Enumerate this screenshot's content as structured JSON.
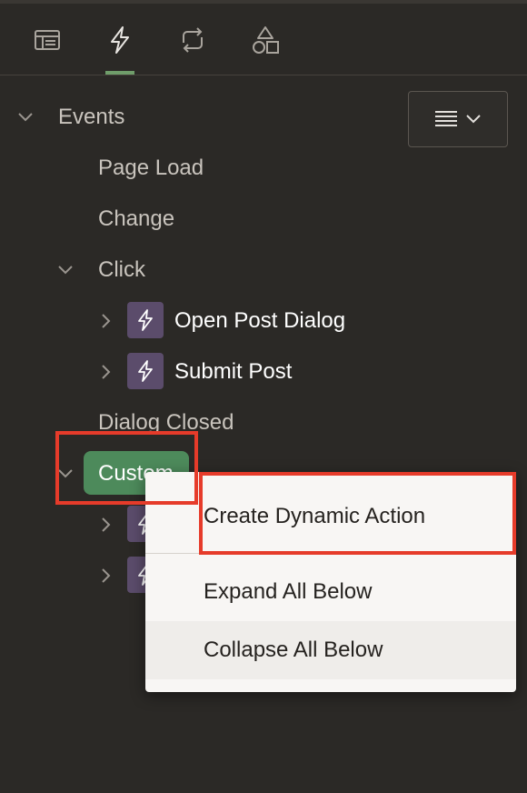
{
  "tabs": [
    {
      "icon": "rendering-icon"
    },
    {
      "icon": "dynamic-actions-icon",
      "active": true
    },
    {
      "icon": "processing-icon"
    },
    {
      "icon": "shared-components-icon"
    }
  ],
  "tree": {
    "events": {
      "label": "Events"
    },
    "page_load": {
      "label": "Page Load"
    },
    "change": {
      "label": "Change"
    },
    "click": {
      "label": "Click"
    },
    "open_post_dialog": {
      "label": "Open Post Dialog"
    },
    "submit_post": {
      "label": "Submit Post"
    },
    "dialog_closed": {
      "label": "Dialog Closed"
    },
    "custom": {
      "label": "Custom"
    }
  },
  "context_menu": {
    "create_dynamic_action": "Create Dynamic Action",
    "expand_all_below": "Expand All Below",
    "collapse_all_below": "Collapse All Below"
  },
  "colors": {
    "background": "#2b2926",
    "accent_green": "#4d8a5b",
    "tab_underline": "#6f9d6a",
    "dynamic_action_icon": "#5b4c6b",
    "highlight_red": "#e63b2a",
    "menu_background": "#f8f6f4",
    "menu_hover": "#efedea"
  }
}
